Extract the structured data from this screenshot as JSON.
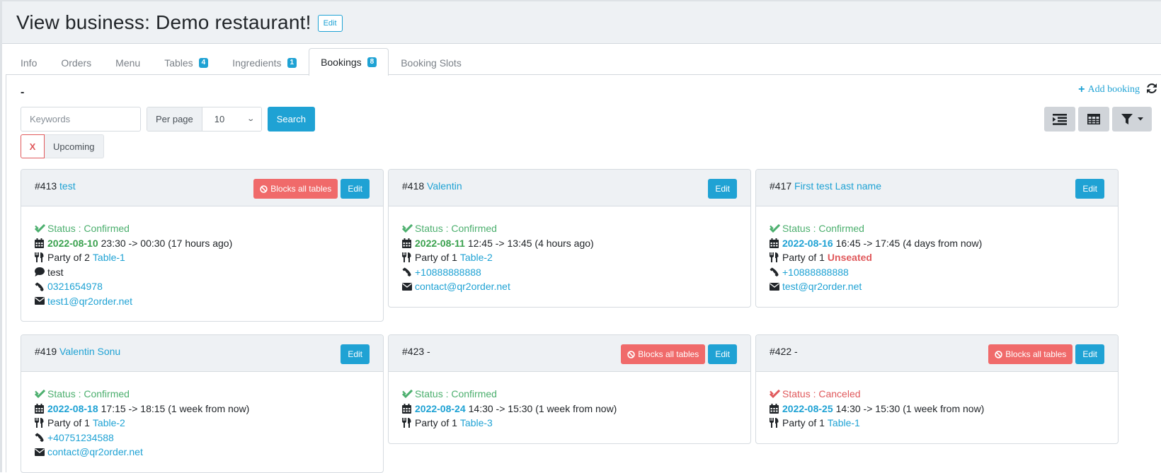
{
  "header": {
    "title": "View business: Demo restaurant!",
    "edit_label": "Edit"
  },
  "tabs": [
    {
      "label": "Info",
      "badge": null,
      "active": false
    },
    {
      "label": "Orders",
      "badge": null,
      "active": false
    },
    {
      "label": "Menu",
      "badge": null,
      "active": false
    },
    {
      "label": "Tables",
      "badge": "4",
      "active": false
    },
    {
      "label": "Ingredients",
      "badge": "1",
      "active": false
    },
    {
      "label": "Bookings",
      "badge": "8",
      "active": true
    },
    {
      "label": "Booking Slots",
      "badge": null,
      "active": false
    }
  ],
  "toolbar": {
    "section_heading": "-",
    "keywords_placeholder": "Keywords",
    "keywords_value": "",
    "per_page_label": "Per page",
    "per_page_value": "10",
    "search_label": "Search",
    "add_booking_label": "Add booking",
    "active_filter": {
      "remove_label": "X",
      "label": "Upcoming"
    },
    "view_buttons": [
      "list-view",
      "table-view",
      "filter-dropdown"
    ]
  },
  "colors": {
    "primary": "#1fa2d4",
    "danger": "#f06a6a",
    "success": "#4caf6e",
    "header_bg": "#eef1f4"
  },
  "bookings": [
    {
      "id": "#413",
      "name": "test",
      "blocks_all_tables": true,
      "status": "Status : Confirmed",
      "status_type": "confirmed",
      "date": "2022-08-10",
      "date_type": "past",
      "time": "23:30 -> 00:30 (17 hours ago)",
      "party": "Party of 2",
      "table": "Table-1",
      "table_unseated": false,
      "comment": "test",
      "phone": "0321654978",
      "email": "test1@qr2order.net"
    },
    {
      "id": "#418",
      "name": "Valentin",
      "blocks_all_tables": false,
      "status": "Status : Confirmed",
      "status_type": "confirmed",
      "date": "2022-08-11",
      "date_type": "past",
      "time": "12:45 -> 13:45 (4 hours ago)",
      "party": "Party of 1",
      "table": "Table-2",
      "table_unseated": false,
      "comment": null,
      "phone": "+10888888888",
      "email": "contact@qr2order.net"
    },
    {
      "id": "#417",
      "name": "First test Last name",
      "blocks_all_tables": false,
      "status": "Status : Confirmed",
      "status_type": "confirmed",
      "date": "2022-08-16",
      "date_type": "future",
      "time": "16:45 -> 17:45 (4 days from now)",
      "party": "Party of 1",
      "table": "Unseated",
      "table_unseated": true,
      "comment": null,
      "phone": "+10888888888",
      "email": "test@qr2order.net"
    },
    {
      "id": "#419",
      "name": "Valentin Sonu",
      "blocks_all_tables": false,
      "status": "Status : Confirmed",
      "status_type": "confirmed",
      "date": "2022-08-18",
      "date_type": "future",
      "time": "17:15 -> 18:15 (1 week from now)",
      "party": "Party of 1",
      "table": "Table-2",
      "table_unseated": false,
      "comment": null,
      "phone": "+40751234588",
      "email": "contact@qr2order.net"
    },
    {
      "id": "#423",
      "name": "-",
      "blocks_all_tables": true,
      "status": "Status : Confirmed",
      "status_type": "confirmed",
      "date": "2022-08-24",
      "date_type": "future",
      "time": "14:30 -> 15:30 (1 week from now)",
      "party": "Party of 1",
      "table": "Table-3",
      "table_unseated": false,
      "comment": null,
      "phone": null,
      "email": null
    },
    {
      "id": "#422",
      "name": "-",
      "blocks_all_tables": true,
      "status": "Status : Canceled",
      "status_type": "canceled",
      "date": "2022-08-25",
      "date_type": "future",
      "time": "14:30 -> 15:30 (1 week from now)",
      "party": "Party of 1",
      "table": "Table-1",
      "table_unseated": false,
      "comment": null,
      "phone": null,
      "email": null
    }
  ],
  "labels": {
    "blocks_all_tables": "Blocks all tables",
    "edit": "Edit"
  }
}
